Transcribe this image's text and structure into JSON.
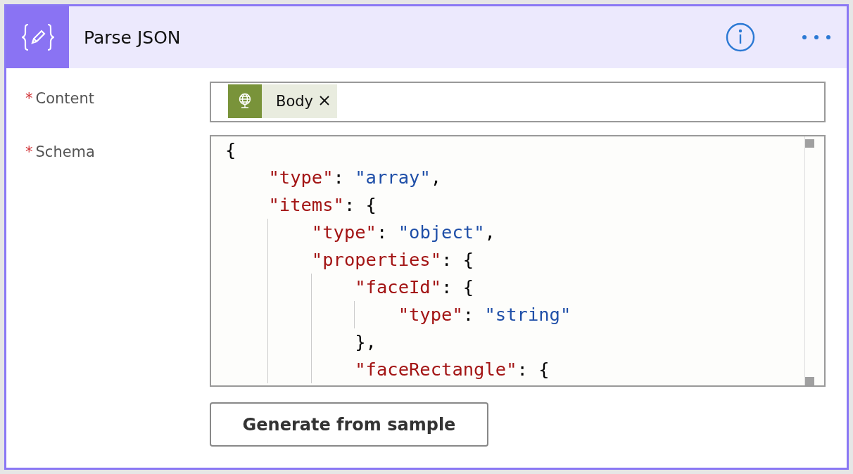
{
  "card": {
    "title": "Parse JSON"
  },
  "fields": [
    {
      "label": "Content",
      "required_mark": "*",
      "kind": "tokens",
      "tokens": [
        {
          "label": "Body"
        }
      ]
    },
    {
      "label": "Schema",
      "required_mark": "*",
      "kind": "code",
      "lines": [
        "{",
        "    \"type\": \"array\",",
        "    \"items\": {",
        "        \"type\": \"object\",",
        "        \"properties\": {",
        "            \"faceId\": {",
        "                \"type\": \"string\"",
        "            },",
        "            \"faceRectangle\": {"
      ]
    }
  ],
  "button": {
    "label": "Generate from sample"
  }
}
